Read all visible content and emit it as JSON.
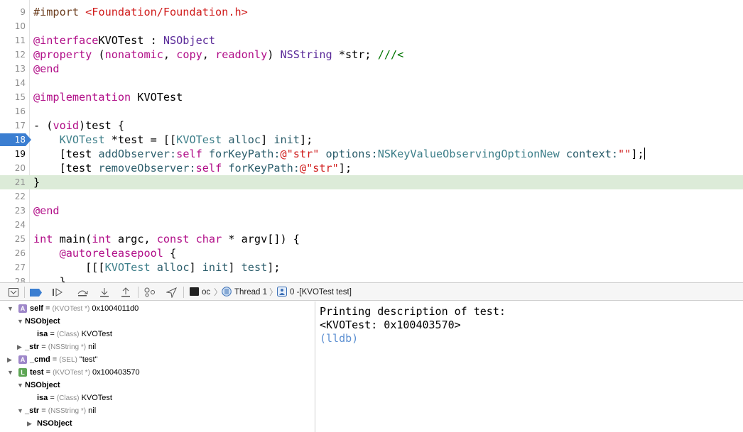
{
  "editor": {
    "lines": [
      {
        "n": "9",
        "tokens": [
          [
            "t-pre",
            "#import "
          ],
          [
            "t-str",
            "<Foundation/Foundation.h>"
          ]
        ]
      },
      {
        "n": "10",
        "tokens": []
      },
      {
        "n": "11",
        "tokens": [
          [
            "t-at",
            "@interface"
          ],
          [
            "",
            "KVOTest : "
          ],
          [
            "t-type",
            "NSObject"
          ]
        ]
      },
      {
        "n": "12",
        "tokens": [
          [
            "t-at",
            "@property"
          ],
          [
            "",
            " ("
          ],
          [
            "t-kw",
            "nonatomic"
          ],
          [
            "",
            ", "
          ],
          [
            "t-kw",
            "copy"
          ],
          [
            "",
            ", "
          ],
          [
            "t-kw",
            "readonly"
          ],
          [
            "",
            ") "
          ],
          [
            "t-type",
            "NSString"
          ],
          [
            "",
            " *str; "
          ],
          [
            "t-com",
            "///<"
          ]
        ]
      },
      {
        "n": "13",
        "tokens": [
          [
            "t-at",
            "@end"
          ]
        ]
      },
      {
        "n": "14",
        "tokens": []
      },
      {
        "n": "15",
        "tokens": [
          [
            "t-at",
            "@implementation"
          ],
          [
            "",
            " KVOTest"
          ]
        ]
      },
      {
        "n": "16",
        "tokens": []
      },
      {
        "n": "17",
        "tokens": [
          [
            "",
            "- ("
          ],
          [
            "t-kw",
            "void"
          ],
          [
            "",
            ")test {"
          ]
        ]
      },
      {
        "n": "18",
        "tokens": [
          [
            "",
            "    "
          ],
          [
            "t-cls",
            "KVOTest"
          ],
          [
            "",
            " *test = [["
          ],
          [
            "t-cls",
            "KVOTest"
          ],
          [
            "",
            " "
          ],
          [
            "t-meth",
            "alloc"
          ],
          [
            "",
            "] "
          ],
          [
            "t-meth",
            "init"
          ],
          [
            "",
            "];"
          ]
        ],
        "breakpoint": true
      },
      {
        "n": "19",
        "tokens": [
          [
            "",
            "    [test "
          ],
          [
            "t-meth",
            "addObserver:"
          ],
          [
            "t-kw",
            "self"
          ],
          [
            "",
            " "
          ],
          [
            "t-meth",
            "forKeyPath:"
          ],
          [
            "t-str",
            "@\"str\""
          ],
          [
            "",
            " "
          ],
          [
            "t-meth",
            "options:"
          ],
          [
            "t-cls",
            "NSKeyValueObservingOptionNew"
          ],
          [
            "",
            " "
          ],
          [
            "t-meth",
            "context:"
          ],
          [
            "t-str",
            "\"\""
          ],
          [
            "",
            "];"
          ]
        ],
        "caret": true,
        "bold_num": true
      },
      {
        "n": "20",
        "tokens": [
          [
            "",
            "    [test "
          ],
          [
            "t-meth",
            "removeObserver:"
          ],
          [
            "t-kw",
            "self"
          ],
          [
            "",
            " "
          ],
          [
            "t-meth",
            "forKeyPath:"
          ],
          [
            "t-str",
            "@\"str\""
          ],
          [
            "",
            "];"
          ]
        ]
      },
      {
        "n": "21",
        "tokens": [
          [
            "",
            "}"
          ]
        ],
        "highlight": true
      },
      {
        "n": "22",
        "tokens": []
      },
      {
        "n": "23",
        "tokens": [
          [
            "t-at",
            "@end"
          ]
        ]
      },
      {
        "n": "24",
        "tokens": []
      },
      {
        "n": "25",
        "tokens": [
          [
            "t-kw",
            "int"
          ],
          [
            "",
            " main("
          ],
          [
            "t-kw",
            "int"
          ],
          [
            "",
            " argc, "
          ],
          [
            "t-kw",
            "const"
          ],
          [
            "",
            " "
          ],
          [
            "t-kw",
            "char"
          ],
          [
            "",
            " * argv[]) {"
          ]
        ]
      },
      {
        "n": "26",
        "tokens": [
          [
            "",
            "    "
          ],
          [
            "t-at",
            "@autoreleasepool"
          ],
          [
            "",
            " {"
          ]
        ]
      },
      {
        "n": "27",
        "tokens": [
          [
            "",
            "        [[["
          ],
          [
            "t-cls",
            "KVOTest"
          ],
          [
            "",
            " "
          ],
          [
            "t-meth",
            "alloc"
          ],
          [
            "",
            "] "
          ],
          [
            "t-meth",
            "init"
          ],
          [
            "",
            "] "
          ],
          [
            "t-meth",
            "test"
          ],
          [
            "",
            "];"
          ]
        ]
      },
      {
        "n": "28",
        "tokens": [
          [
            "",
            "    }"
          ]
        ]
      }
    ]
  },
  "debug_bar": {
    "icons": [
      "hide-debug-area-icon",
      "breakpoints-toggle-icon",
      "continue-icon",
      "step-over-icon",
      "step-into-icon",
      "step-out-icon",
      "debug-view-hierarchy-icon",
      "simulate-location-icon"
    ],
    "process": "oc",
    "thread": "Thread 1",
    "frame": "0 -[KVOTest test]"
  },
  "variables": [
    {
      "indent": 0,
      "tri": "▼",
      "badge": "A",
      "name": "self",
      "type": "(KVOTest *)",
      "value": "0x1004011d0"
    },
    {
      "indent": 1,
      "tri": "▼",
      "name": "NSObject"
    },
    {
      "indent": 2,
      "name": "isa",
      "type": "(Class)",
      "value": "KVOTest",
      "plain": true
    },
    {
      "indent": 1,
      "tri": "▶",
      "name": "_str",
      "type": "(NSString *)",
      "value": "nil",
      "plain": true
    },
    {
      "indent": 0,
      "tri": "▶",
      "badge": "A",
      "name": "_cmd",
      "type": "(SEL)",
      "value": "\"test\""
    },
    {
      "indent": 0,
      "tri": "▼",
      "badge": "L",
      "name": "test",
      "type": "(KVOTest *)",
      "value": "0x100403570"
    },
    {
      "indent": 1,
      "tri": "▼",
      "name": "NSObject"
    },
    {
      "indent": 2,
      "name": "isa",
      "type": "(Class)",
      "value": "KVOTest",
      "plain": true
    },
    {
      "indent": 1,
      "tri": "▼",
      "name": "_str",
      "type": "(NSString *)",
      "value": "nil",
      "plain": true
    },
    {
      "indent": 2,
      "tri": "▶",
      "name": "NSObject"
    }
  ],
  "console": {
    "lines": [
      "Printing description of test:",
      "<KVOTest: 0x100403570>"
    ],
    "prompt": "(lldb)"
  },
  "colors": {
    "breakpoint": "#3b7ed1",
    "current_line": "#dcebd8",
    "keyword": "#b10e88",
    "string": "#d01c1c",
    "comment": "#007400"
  }
}
